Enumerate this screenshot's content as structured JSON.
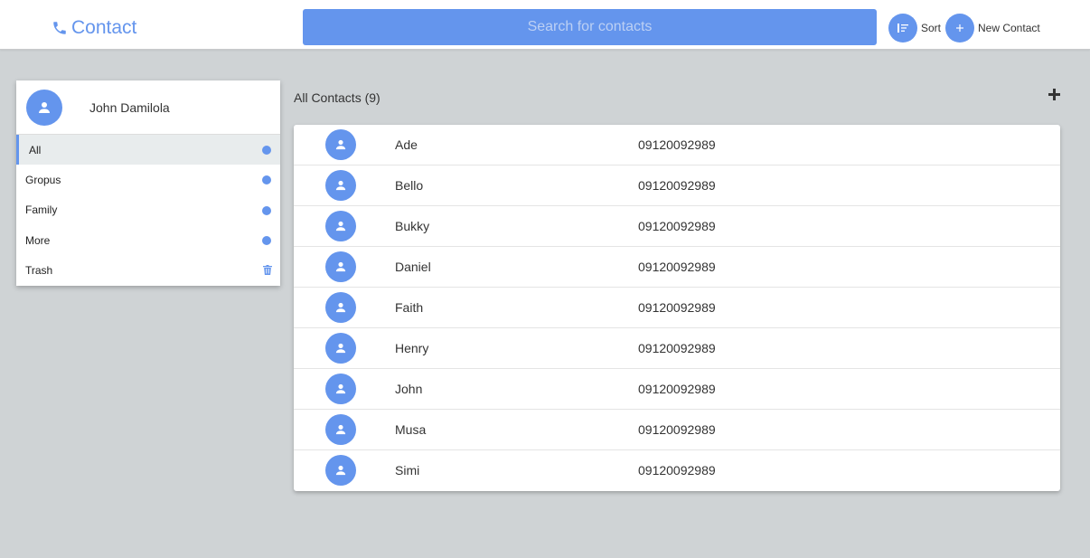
{
  "header": {
    "brand_label": "Contact",
    "search_placeholder": "Search for contacts",
    "sort_label": "Sort",
    "new_contact_label": "New Contact",
    "accent_color": "#6495ed"
  },
  "sidebar": {
    "user_name": "John Damilola",
    "items": [
      {
        "label": "All",
        "icon": "dot-icon",
        "active": true
      },
      {
        "label": "Gropus",
        "icon": "dot-icon"
      },
      {
        "label": "Family",
        "icon": "dot-icon"
      },
      {
        "label": "More",
        "icon": "dot-icon"
      },
      {
        "label": "Trash",
        "icon": "trash-icon"
      }
    ]
  },
  "contacts": {
    "header": "All Contacts (9)",
    "rows": [
      {
        "name": "Ade",
        "phone": "09120092989"
      },
      {
        "name": "Bello",
        "phone": "09120092989"
      },
      {
        "name": "Bukky",
        "phone": "09120092989"
      },
      {
        "name": "Daniel",
        "phone": "09120092989"
      },
      {
        "name": "Faith",
        "phone": "09120092989"
      },
      {
        "name": "Henry",
        "phone": "09120092989"
      },
      {
        "name": "John",
        "phone": "09120092989"
      },
      {
        "name": "Musa",
        "phone": "09120092989"
      },
      {
        "name": "Simi",
        "phone": "09120092989"
      }
    ]
  }
}
